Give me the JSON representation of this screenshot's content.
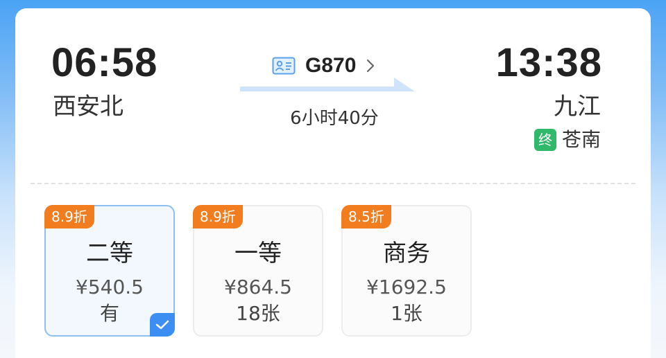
{
  "departure": {
    "time": "06:58",
    "station": "西安北"
  },
  "arrival": {
    "time": "13:38",
    "station": "九江"
  },
  "train": {
    "code": "G870",
    "icon": "id-card-icon"
  },
  "duration": "6小时40分",
  "terminal": {
    "badge": "终",
    "station": "苍南"
  },
  "seats": [
    {
      "discount": "8.9折",
      "class": "二等",
      "price": "¥540.5",
      "availability": "有",
      "selected": true
    },
    {
      "discount": "8.9折",
      "class": "一等",
      "price": "¥864.5",
      "availability": "18张",
      "selected": false
    },
    {
      "discount": "8.5折",
      "class": "商务",
      "price": "¥1692.5",
      "availability": "1张",
      "selected": false
    }
  ],
  "colors": {
    "accent": "#3d8ef2",
    "discount": "#f27d1e",
    "terminal_badge": "#30b86b"
  }
}
